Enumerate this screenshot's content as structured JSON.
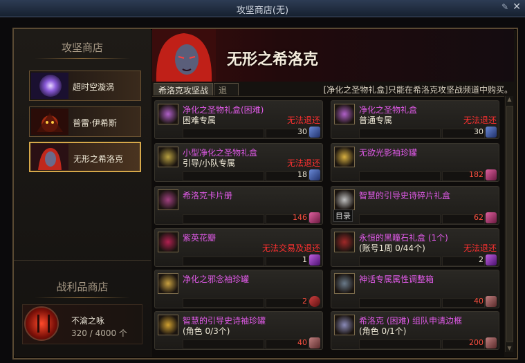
{
  "window": {
    "title": "攻坚商店(无)",
    "pin_icon": "pin-icon",
    "close_icon": "close-icon"
  },
  "left_panel": {
    "heading": "攻坚商店",
    "dungeons": [
      {
        "label": "超时空漩涡",
        "selected": false
      },
      {
        "label": "普雷·伊希斯",
        "selected": false
      },
      {
        "label": "无形之希洛克",
        "selected": true
      }
    ],
    "spoils_heading": "战利品商店",
    "spoils": {
      "name": "不渝之咏",
      "value": "320 / 4000 个"
    }
  },
  "banner": {
    "title": "无形之希洛克"
  },
  "tabs": [
    {
      "label": "希洛克攻坚战",
      "active": true
    },
    {
      "label": "退还",
      "active": false
    }
  ],
  "notice": "[净化之圣物礼盒]只能在希洛克攻坚战频道中购买。",
  "tooltip": "目录",
  "items": [
    {
      "name": "净化之圣物礼盒(困难)",
      "sub": "困难专属",
      "warn": "无法退还",
      "price": "30",
      "price_color": "white",
      "currency": "blue",
      "icon": "gift-box-icon"
    },
    {
      "name": "净化之圣物礼盒",
      "sub": "普通专属",
      "warn": "无法退还",
      "price": "30",
      "price_color": "white",
      "currency": "blue",
      "icon": "gift-box-icon"
    },
    {
      "name": "小型净化之圣物礼盒",
      "sub": "引导/小队专属",
      "warn": "无法退还",
      "price": "18",
      "price_color": "white",
      "currency": "blue",
      "icon": "small-gift-box-icon"
    },
    {
      "name": "无欲光影袖珍罐",
      "sub": "",
      "warn": "",
      "price": "182",
      "price_color": "red",
      "currency": "pink",
      "icon": "jar-icon"
    },
    {
      "name": "希洛克卡片册",
      "sub": "",
      "warn": "",
      "price": "146",
      "price_color": "red",
      "currency": "pink",
      "icon": "card-album-icon"
    },
    {
      "name": "智慧的引导史诗碎片礼盒",
      "sub": "",
      "warn": "",
      "price": "62",
      "price_color": "red",
      "currency": "pink",
      "icon": "epic-fragment-box-icon"
    },
    {
      "name": "紫英花瓣",
      "sub": "",
      "warn": "无法交易及退还",
      "price": "1",
      "price_color": "white",
      "currency": "purple",
      "icon": "petal-icon"
    },
    {
      "name": "永恒的黑瞳石礼盒 (1个)",
      "sub": "(账号1周 0/44个)",
      "warn": "无法退还",
      "price": "2",
      "price_color": "white",
      "currency": "purple",
      "icon": "black-stone-box-icon"
    },
    {
      "name": "净化之邪念袖珍罐",
      "sub": "",
      "warn": "",
      "price": "2",
      "price_color": "red",
      "currency": "red",
      "icon": "orb-jar-icon"
    },
    {
      "name": "神话专属属性调整箱",
      "sub": "",
      "warn": "",
      "price": "40",
      "price_color": "red",
      "currency": "rose",
      "icon": "mythic-box-icon"
    },
    {
      "name": "智慧的引导史诗袖珍罐",
      "sub": "(角色 0/3个)",
      "warn": "",
      "price": "40",
      "price_color": "red",
      "currency": "rose",
      "icon": "epic-jar-icon"
    },
    {
      "name": "希洛克 (困难) 组队申请边框",
      "sub": "(角色 0/1个)",
      "warn": "",
      "price": "200",
      "price_color": "red",
      "currency": "rose",
      "icon": "party-frame-icon"
    }
  ]
}
